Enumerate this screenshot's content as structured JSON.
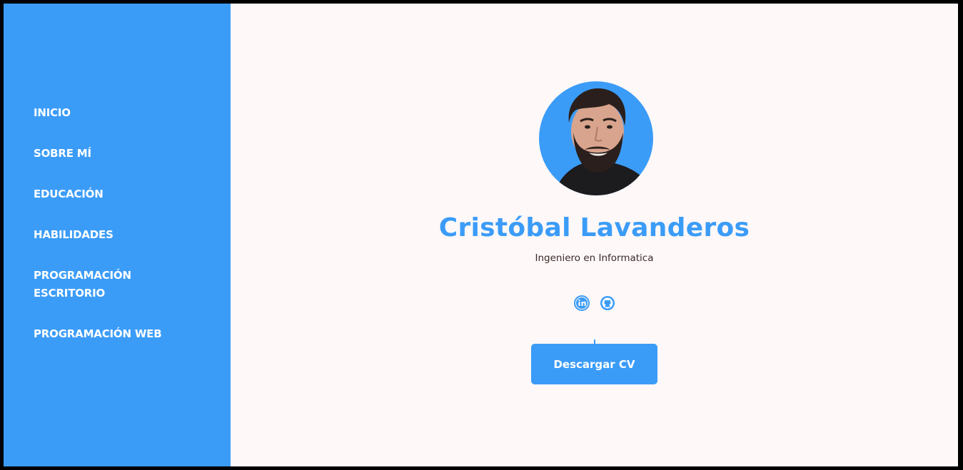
{
  "sidebar": {
    "items": [
      {
        "label": "INICIO"
      },
      {
        "label": "SOBRE MÍ"
      },
      {
        "label": "EDUCACIÓN"
      },
      {
        "label": "HABILIDADES"
      },
      {
        "label": "PROGRAMACIÓN ESCRITORIO"
      },
      {
        "label": "PROGRAMACIÓN WEB"
      }
    ]
  },
  "profile": {
    "name": "Cristóbal Lavanderos",
    "role": "Ingeniero en Informatica",
    "socials": [
      {
        "icon": "linkedin-icon"
      },
      {
        "icon": "github-icon"
      }
    ],
    "cv_button": "Descargar CV"
  },
  "colors": {
    "accent": "#3b9cf8",
    "background": "#fff8f8",
    "frame": "#000000",
    "role_text": "#3a2a2a"
  }
}
